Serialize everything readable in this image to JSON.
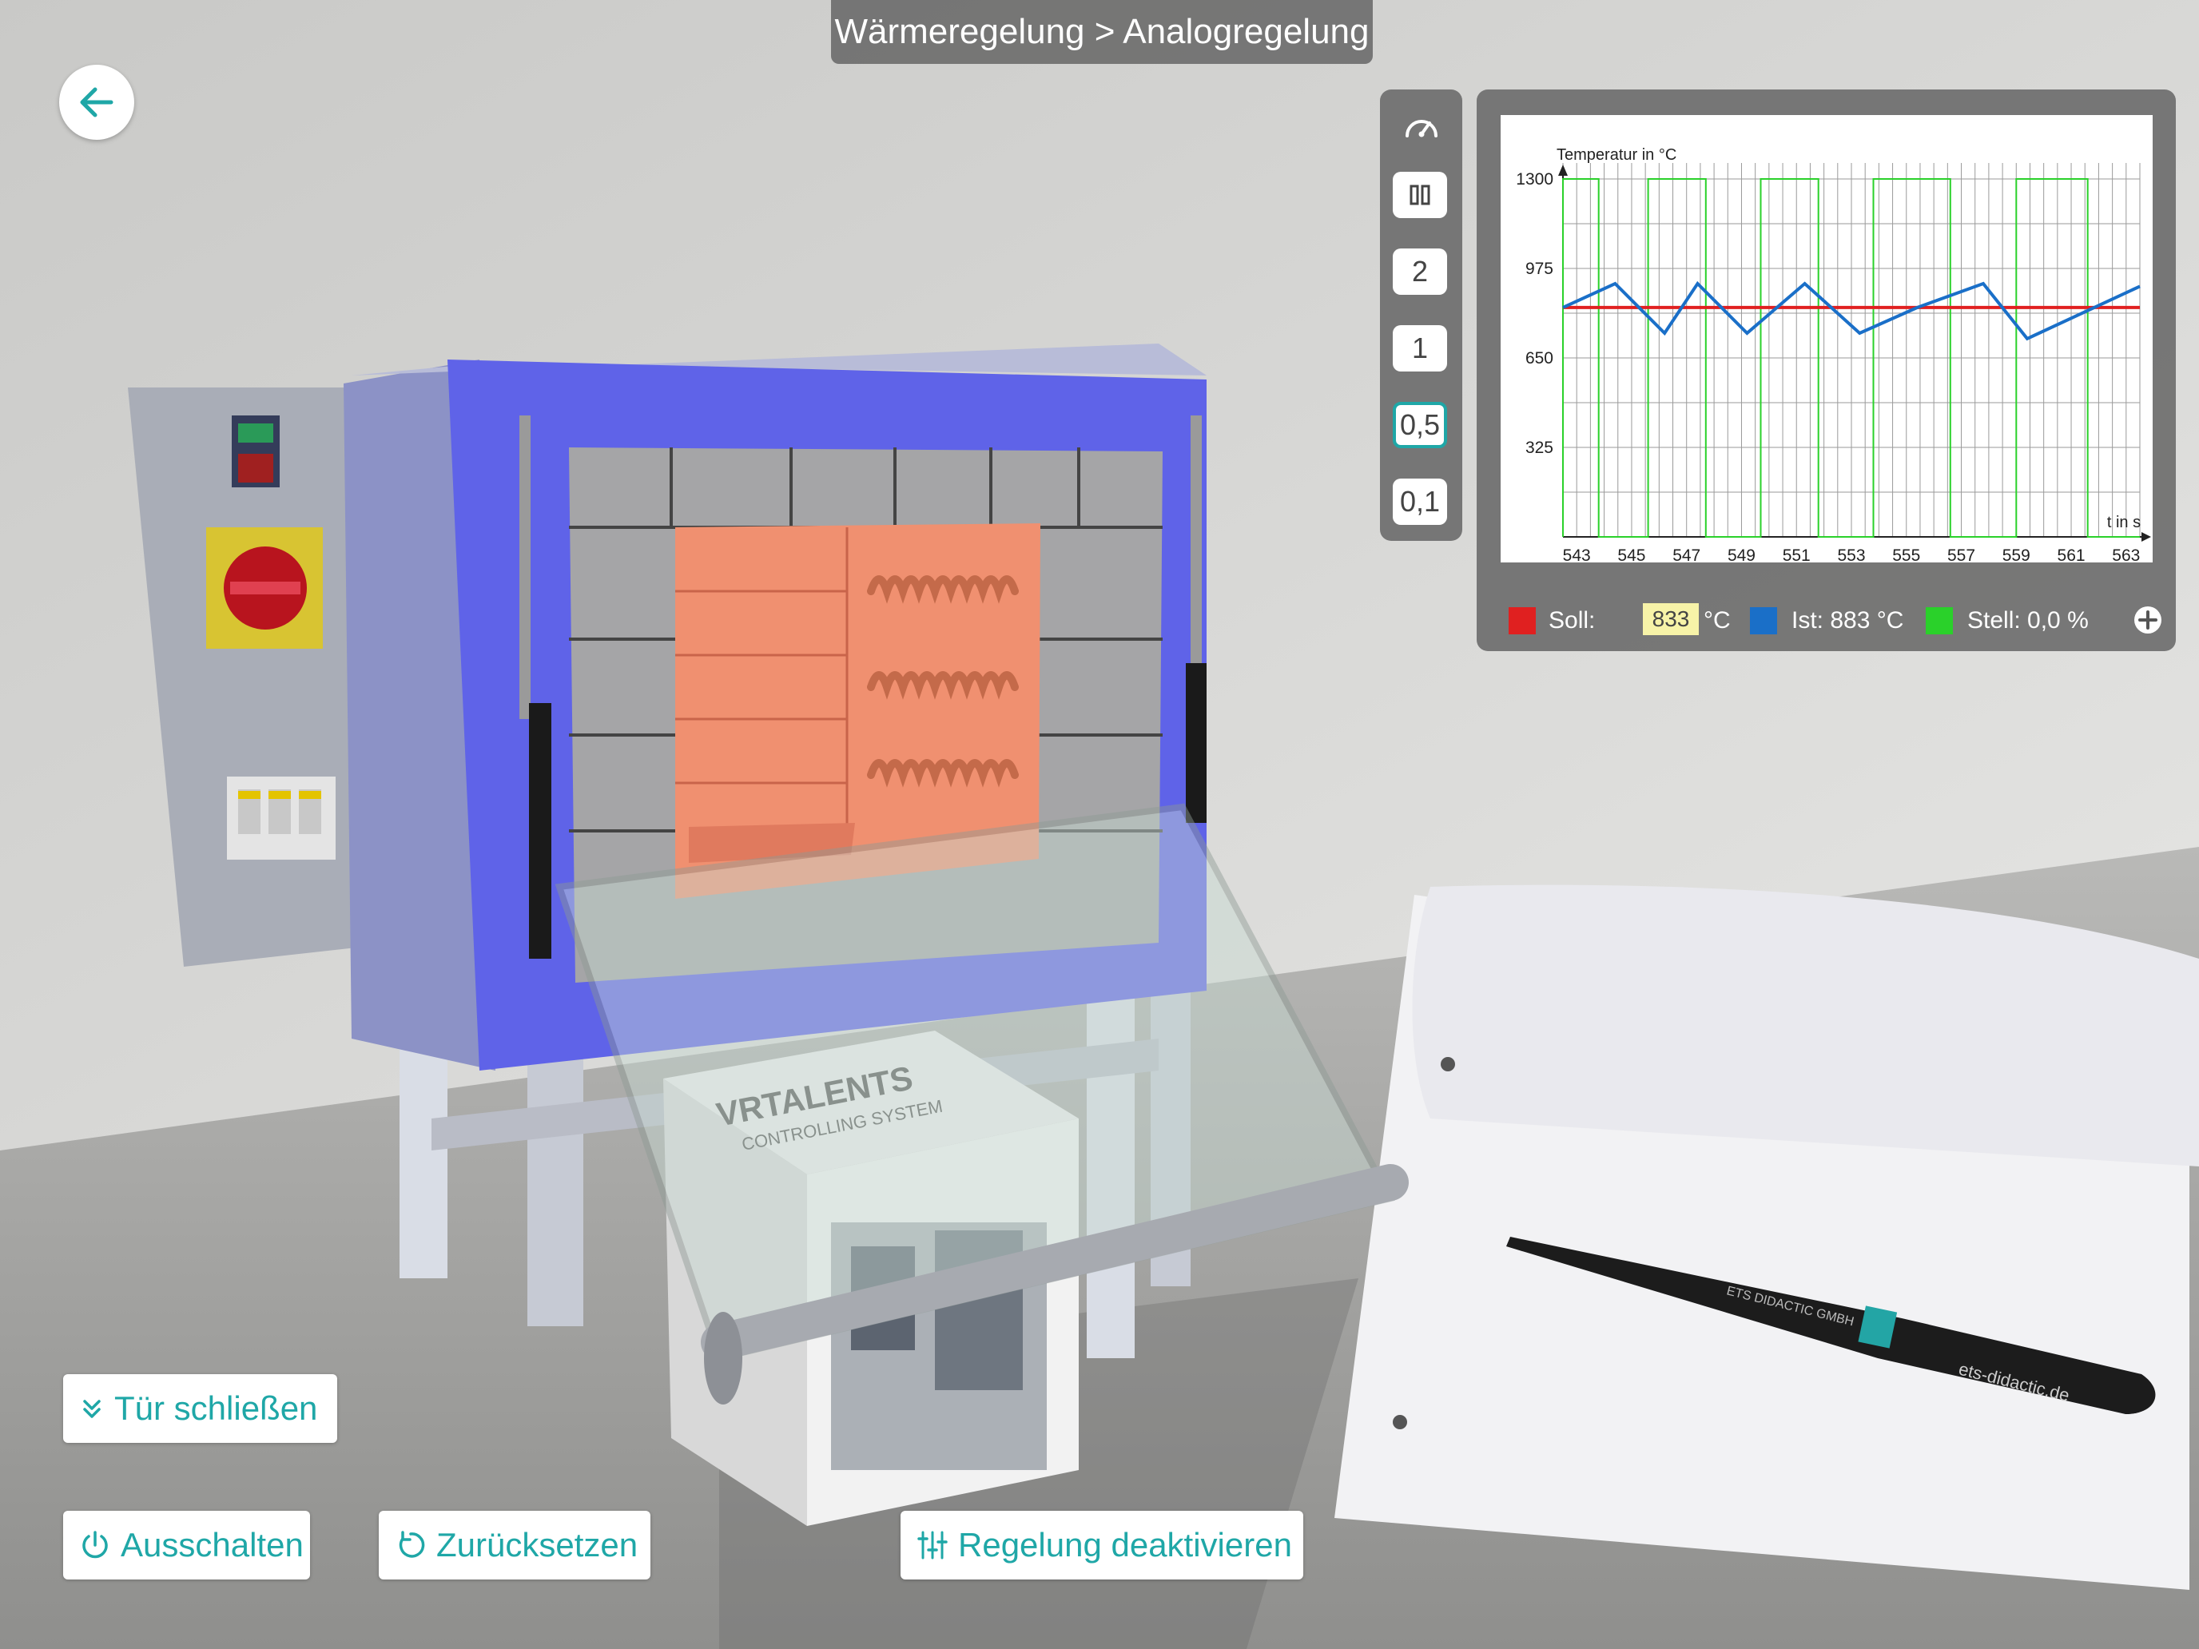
{
  "breadcrumb": "Wärmeregelung > Analogregelung",
  "speed_toolbar": {
    "icon": "speedometer-icon",
    "pause_icon": "pause-icon",
    "options": [
      "2",
      "1",
      "0,5",
      "0,1"
    ],
    "active": "0,5"
  },
  "chart_data": {
    "type": "line",
    "ylabel": "Temperatur in °C",
    "xlabel": "t in s",
    "y_ticks": [
      "1300",
      "975",
      "650",
      "325"
    ],
    "x_ticks": [
      "543",
      "545",
      "547",
      "549",
      "551",
      "553",
      "555",
      "557",
      "559",
      "561",
      "563"
    ],
    "xlim": [
      542.5,
      563.5
    ],
    "ylim": [
      0,
      1300
    ],
    "series": [
      {
        "name": "Soll",
        "color": "#e02020",
        "x": [
          542.5,
          563.5
        ],
        "y": [
          833,
          833
        ]
      },
      {
        "name": "Ist",
        "color": "#1a6fc8",
        "x": [
          542.5,
          544.4,
          546.2,
          547.4,
          549.2,
          551.3,
          553.3,
          555.4,
          557.8,
          559.4,
          563.5
        ],
        "y": [
          833,
          920,
          740,
          920,
          740,
          920,
          740,
          833,
          920,
          720,
          910
        ]
      },
      {
        "name": "Stell",
        "color": "#2ad12a",
        "x": [
          542.5,
          542.5,
          543.8,
          543.8,
          545.6,
          545.6,
          547.7,
          547.7,
          549.7,
          549.7,
          551.8,
          551.8,
          553.8,
          553.8,
          556.6,
          556.6,
          559.0,
          559.0,
          561.6,
          561.6,
          563.5
        ],
        "y": [
          0,
          1300,
          1300,
          0,
          0,
          1300,
          1300,
          0,
          0,
          1300,
          1300,
          0,
          0,
          1300,
          1300,
          0,
          0,
          1300,
          1300,
          0,
          0
        ]
      }
    ],
    "legend_position": "bottom"
  },
  "legend": {
    "soll_label": "Soll:",
    "soll_value": "833",
    "soll_unit": "°C",
    "ist_text": "Ist: 883 °C",
    "stell_text": "Stell: 0,0 %",
    "colors": {
      "soll": "#e02020",
      "ist": "#1a6fc8",
      "stell": "#2ad12a"
    }
  },
  "buttons": {
    "close_door": "Tür schließen",
    "power_off": "Ausschalten",
    "reset": "Zurücksetzen",
    "deactivate_control": "Regelung deaktivieren"
  },
  "scene": {
    "box_brand": "VRTALENTS",
    "box_subtitle": "CONTROLLING SYSTEM",
    "pen_text": "ets-didactic.de",
    "pen_brand": "ETS DIDACTIC GMBH"
  },
  "colors": {
    "accent": "#1fa7a7",
    "furnace_frame": "#5f63e8",
    "chamber": "#f09070"
  }
}
